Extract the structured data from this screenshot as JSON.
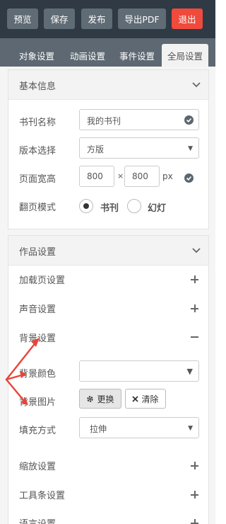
{
  "topbar": {
    "preview": "预览",
    "save": "保存",
    "publish": "发布",
    "export_pdf": "导出PDF",
    "exit": "退出"
  },
  "tabs": [
    "对象设置",
    "动画设置",
    "事件设置",
    "全局设置"
  ],
  "basic_panel": {
    "title": "基本信息",
    "book_name_label": "书刊名称",
    "book_name_value": "我的书刊",
    "version_label": "版本选择",
    "version_value": "方版",
    "page_size_label": "页面宽高",
    "width_value": "800",
    "times": "×",
    "height_value": "800",
    "unit": "px",
    "flip_label": "翻页模式",
    "flip_options": [
      "书刊",
      "幻灯"
    ],
    "flip_selected": "书刊"
  },
  "work_panel": {
    "title": "作品设置",
    "loading_label": "加载页设置",
    "sound_label": "声音设置",
    "bg_label": "背景设置",
    "bg_color_label": "背景颜色",
    "bg_image_label": "背景图片",
    "replace_button": "更换",
    "clear_button": "清除",
    "fill_label": "填充方式",
    "fill_value": "拉伸",
    "zoom_label": "缩放设置",
    "toolbar_label": "工具条设置",
    "language_label": "语言设置"
  },
  "colors": {
    "topbar_bg": "#2f3a45",
    "button_bg": "#5f6b75",
    "exit_bg": "#ef4a3c",
    "tabs_bg": "#5d6872",
    "annotation_red": "#e8443a"
  }
}
